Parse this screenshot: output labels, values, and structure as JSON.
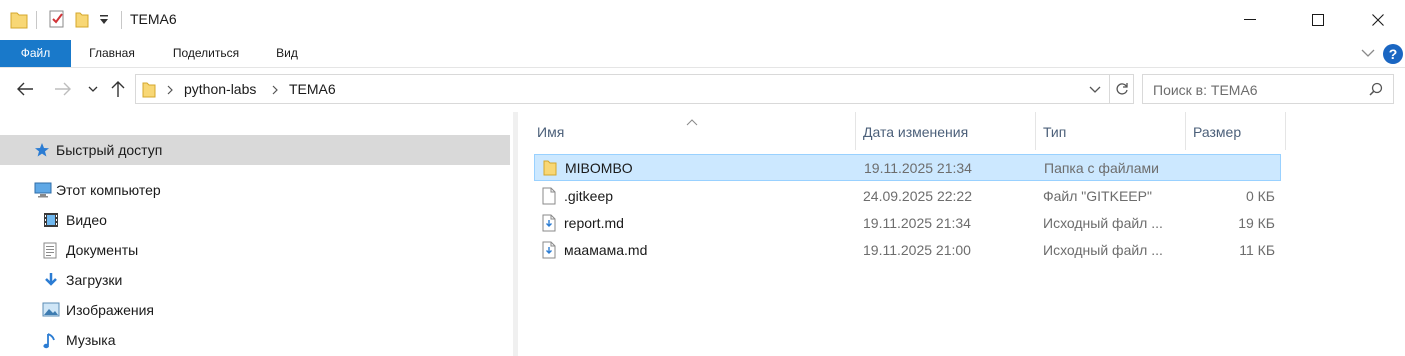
{
  "window": {
    "title": "TEMA6",
    "quick_access_toolbar": [
      "folder-icon",
      "properties-icon",
      "new-folder-icon",
      "customize-dropdown-icon"
    ]
  },
  "ribbon": {
    "tabs": [
      "Файл",
      "Главная",
      "Поделиться",
      "Вид"
    ],
    "active_tab": "Файл",
    "accent_color": "#1979ca"
  },
  "address": {
    "breadcrumbs": [
      "python-labs",
      "TEMA6"
    ],
    "search_placeholder": "Поиск в: TEMA6"
  },
  "nav": {
    "quick_access": "Быстрый доступ",
    "this_pc": "Этот компьютер",
    "items": [
      {
        "label": "Видео",
        "icon": "video-icon"
      },
      {
        "label": "Документы",
        "icon": "documents-icon"
      },
      {
        "label": "Загрузки",
        "icon": "downloads-icon"
      },
      {
        "label": "Изображения",
        "icon": "pictures-icon"
      },
      {
        "label": "Музыка",
        "icon": "music-icon"
      }
    ]
  },
  "columns": {
    "name": "Имя",
    "date": "Дата изменения",
    "type": "Тип",
    "size": "Размер"
  },
  "files": [
    {
      "name": "MIBOMBO",
      "date": "19.11.2025 21:34",
      "type": "Папка с файлами",
      "size": "",
      "icon": "folder-icon",
      "selected": true
    },
    {
      "name": ".gitkeep",
      "date": "24.09.2025 22:22",
      "type": "Файл \"GITKEEP\"",
      "size": "0 КБ",
      "icon": "file-icon",
      "selected": false
    },
    {
      "name": "report.md",
      "date": "19.11.2025 21:34",
      "type": "Исходный файл ...",
      "size": "19 КБ",
      "icon": "md-file-icon",
      "selected": false
    },
    {
      "name": "маамама.md",
      "date": "19.11.2025 21:00",
      "type": "Исходный файл ...",
      "size": "11 КБ",
      "icon": "md-file-icon",
      "selected": false
    }
  ],
  "colors": {
    "selection_bg": "#cce8ff",
    "selection_border": "#99d1ff",
    "nav_selected_bg": "#d9d9d9",
    "folder_yellow": "#f8d775"
  }
}
